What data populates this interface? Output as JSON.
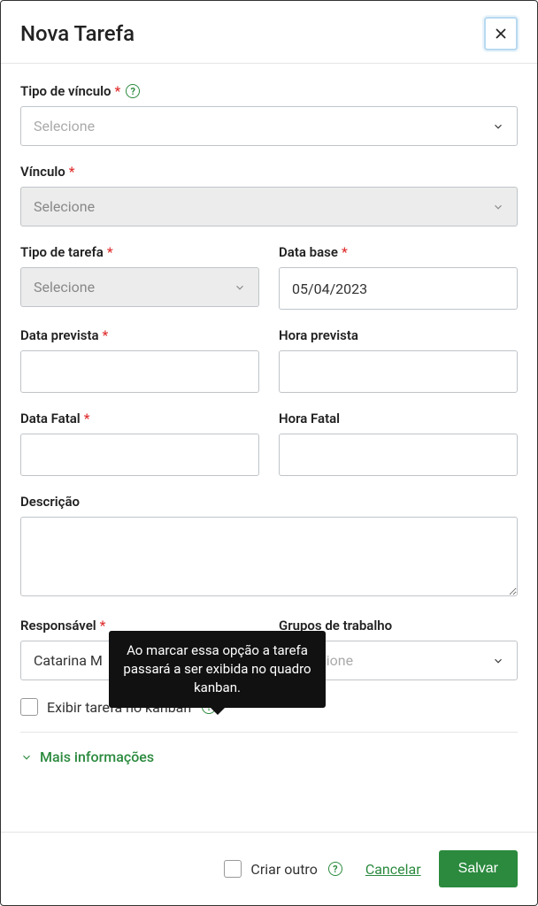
{
  "header": {
    "title": "Nova Tarefa"
  },
  "form": {
    "tipo_vinculo": {
      "label": "Tipo de vínculo",
      "placeholder": "Selecione"
    },
    "vinculo": {
      "label": "Vínculo",
      "placeholder": "Selecione"
    },
    "tipo_tarefa": {
      "label": "Tipo de tarefa",
      "placeholder": "Selecione"
    },
    "data_base": {
      "label": "Data base",
      "value": "05/04/2023"
    },
    "data_prevista": {
      "label": "Data prevista",
      "value": ""
    },
    "hora_prevista": {
      "label": "Hora prevista",
      "value": ""
    },
    "data_fatal": {
      "label": "Data Fatal",
      "value": ""
    },
    "hora_fatal": {
      "label": "Hora Fatal",
      "value": ""
    },
    "descricao": {
      "label": "Descrição",
      "value": ""
    },
    "responsavel": {
      "label": "Responsável",
      "value": "Catarina M"
    },
    "grupos": {
      "label": "Grupos de trabalho",
      "placeholder": "Selecione"
    },
    "kanban_checkbox": {
      "label": "Exibir tarefa no kanban"
    }
  },
  "tooltip": {
    "text": "Ao marcar essa opção a tarefa passará a ser exibida no quadro kanban."
  },
  "more_info": {
    "label": "Mais informações"
  },
  "footer": {
    "criar_outro": "Criar outro",
    "cancelar": "Cancelar",
    "salvar": "Salvar"
  }
}
